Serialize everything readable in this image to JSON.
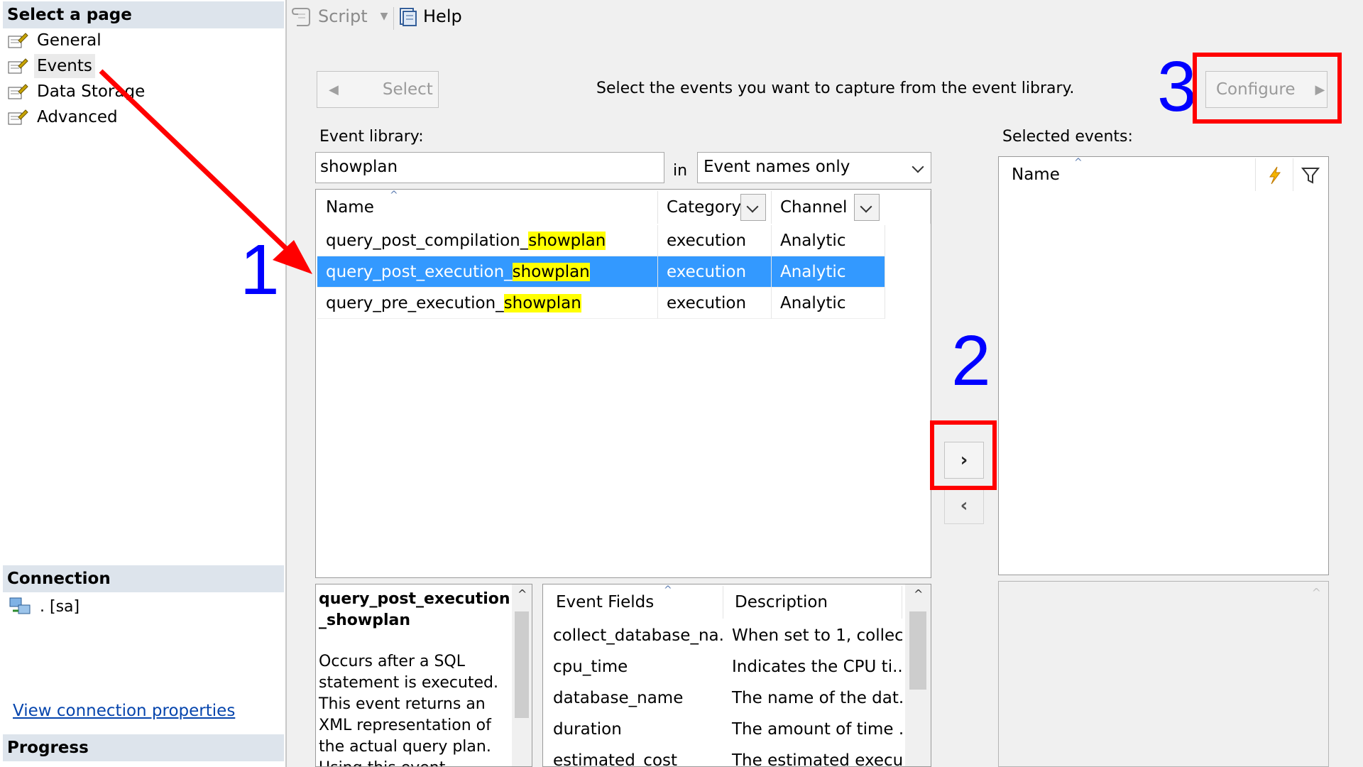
{
  "left_pane": {
    "select_page_header": "Select a page",
    "pages": [
      {
        "label": "General"
      },
      {
        "label": "Events"
      },
      {
        "label": "Data Storage"
      },
      {
        "label": "Advanced"
      }
    ],
    "connection_header": "Connection",
    "connection_value": ". [sa]",
    "view_connection_link": "View connection properties",
    "progress_header": "Progress"
  },
  "toolbar": {
    "script_label": "Script",
    "help_label": "Help"
  },
  "events": {
    "select_button": "Select",
    "instruction": "Select the events you want to capture from the event library.",
    "configure_button": "Configure",
    "event_library_label": "Event library:",
    "search_value": "showplan",
    "in_label": "in",
    "search_scope": "Event names only",
    "columns": {
      "name": "Name",
      "category": "Category",
      "channel": "Channel"
    },
    "rows": [
      {
        "name_prefix": "query_post_compilation_",
        "name_match": "showplan",
        "category": "execution",
        "channel": "Analytic",
        "selected": false
      },
      {
        "name_prefix": "query_post_execution_",
        "name_match": "showplan",
        "category": "execution",
        "channel": "Analytic",
        "selected": true
      },
      {
        "name_prefix": "query_pre_execution_",
        "name_match": "showplan",
        "category": "execution",
        "channel": "Analytic",
        "selected": false
      }
    ],
    "selected_events_label": "Selected events:",
    "selected_columns": {
      "name": "Name"
    },
    "description_title": "query_post_execution_showplan",
    "description_text": "Occurs after a SQL statement is executed. This event returns an XML representation of the actual query plan. Using this event",
    "fields_columns": {
      "fields": "Event Fields",
      "description": "Description"
    },
    "fields": [
      {
        "name": "collect_database_na...",
        "description": "When set to 1, collec..."
      },
      {
        "name": "cpu_time",
        "description": "Indicates the CPU ti..."
      },
      {
        "name": "database_name",
        "description": "The name of the dat..."
      },
      {
        "name": "duration",
        "description": "The amount of time ..."
      },
      {
        "name": "estimated_cost",
        "description": "The estimated execu..."
      }
    ]
  },
  "annotations": {
    "step1": "1",
    "step2": "2",
    "step3": "3"
  },
  "colors": {
    "selection": "#3399ff",
    "highlight": "#ffff00",
    "annotation_red": "#ff0000",
    "annotation_blue": "#0000ff"
  }
}
